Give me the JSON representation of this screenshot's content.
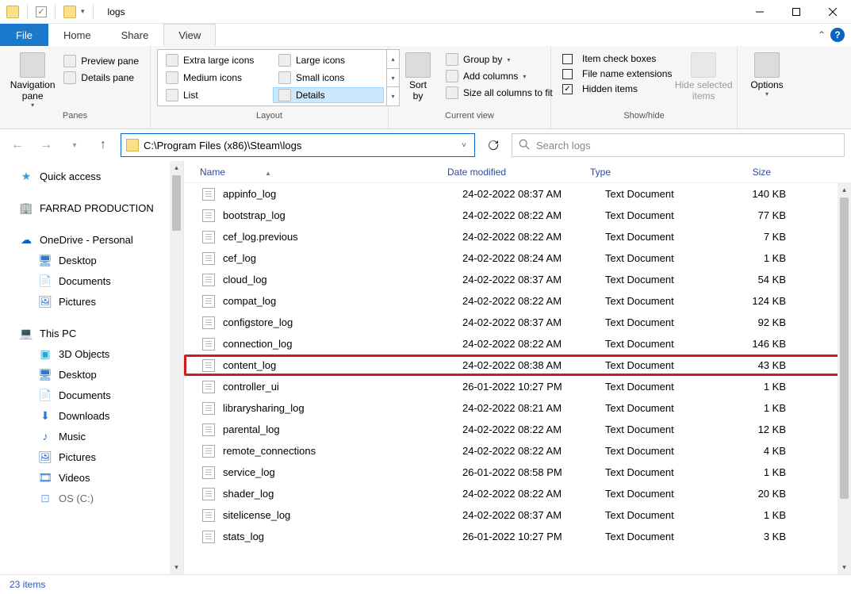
{
  "title": "logs",
  "tabs": {
    "file": "File",
    "home": "Home",
    "share": "Share",
    "view": "View"
  },
  "ribbon": {
    "panes_group": "Panes",
    "nav_pane": "Navigation\npane",
    "preview_pane": "Preview pane",
    "details_pane": "Details pane",
    "layout_group": "Layout",
    "layout": {
      "xl": "Extra large icons",
      "lg": "Large icons",
      "md": "Medium icons",
      "sm": "Small icons",
      "list": "List",
      "details": "Details"
    },
    "currentview_group": "Current view",
    "sort_by": "Sort\nby",
    "group_by": "Group by",
    "add_columns": "Add columns",
    "size_all": "Size all columns to fit",
    "showhide_group": "Show/hide",
    "item_check": "Item check boxes",
    "file_ext": "File name extensions",
    "hidden": "Hidden items",
    "hide_selected": "Hide selected\nitems",
    "options": "Options"
  },
  "address_path": "C:\\Program Files (x86)\\Steam\\logs",
  "search_placeholder": "Search logs",
  "nav": {
    "quick": "Quick access",
    "farrad": "FARRAD PRODUCTION",
    "onedrive": "OneDrive - Personal",
    "od_desktop": "Desktop",
    "od_documents": "Documents",
    "od_pictures": "Pictures",
    "thispc": "This PC",
    "3d": "3D Objects",
    "desktop": "Desktop",
    "documents": "Documents",
    "downloads": "Downloads",
    "music": "Music",
    "pictures": "Pictures",
    "videos": "Videos",
    "osc": "OS (C:)"
  },
  "columns": {
    "name": "Name",
    "date": "Date modified",
    "type": "Type",
    "size": "Size"
  },
  "files": [
    {
      "name": "appinfo_log",
      "date": "24-02-2022 08:37 AM",
      "type": "Text Document",
      "size": "140 KB",
      "hl": false
    },
    {
      "name": "bootstrap_log",
      "date": "24-02-2022 08:22 AM",
      "type": "Text Document",
      "size": "77 KB",
      "hl": false
    },
    {
      "name": "cef_log.previous",
      "date": "24-02-2022 08:22 AM",
      "type": "Text Document",
      "size": "7 KB",
      "hl": false
    },
    {
      "name": "cef_log",
      "date": "24-02-2022 08:24 AM",
      "type": "Text Document",
      "size": "1 KB",
      "hl": false
    },
    {
      "name": "cloud_log",
      "date": "24-02-2022 08:37 AM",
      "type": "Text Document",
      "size": "54 KB",
      "hl": false
    },
    {
      "name": "compat_log",
      "date": "24-02-2022 08:22 AM",
      "type": "Text Document",
      "size": "124 KB",
      "hl": false
    },
    {
      "name": "configstore_log",
      "date": "24-02-2022 08:37 AM",
      "type": "Text Document",
      "size": "92 KB",
      "hl": false
    },
    {
      "name": "connection_log",
      "date": "24-02-2022 08:22 AM",
      "type": "Text Document",
      "size": "146 KB",
      "hl": false
    },
    {
      "name": "content_log",
      "date": "24-02-2022 08:38 AM",
      "type": "Text Document",
      "size": "43 KB",
      "hl": true
    },
    {
      "name": "controller_ui",
      "date": "26-01-2022 10:27 PM",
      "type": "Text Document",
      "size": "1 KB",
      "hl": false
    },
    {
      "name": "librarysharing_log",
      "date": "24-02-2022 08:21 AM",
      "type": "Text Document",
      "size": "1 KB",
      "hl": false
    },
    {
      "name": "parental_log",
      "date": "24-02-2022 08:22 AM",
      "type": "Text Document",
      "size": "12 KB",
      "hl": false
    },
    {
      "name": "remote_connections",
      "date": "24-02-2022 08:22 AM",
      "type": "Text Document",
      "size": "4 KB",
      "hl": false
    },
    {
      "name": "service_log",
      "date": "26-01-2022 08:58 PM",
      "type": "Text Document",
      "size": "1 KB",
      "hl": false
    },
    {
      "name": "shader_log",
      "date": "24-02-2022 08:22 AM",
      "type": "Text Document",
      "size": "20 KB",
      "hl": false
    },
    {
      "name": "sitelicense_log",
      "date": "24-02-2022 08:37 AM",
      "type": "Text Document",
      "size": "1 KB",
      "hl": false
    },
    {
      "name": "stats_log",
      "date": "26-01-2022 10:27 PM",
      "type": "Text Document",
      "size": "3 KB",
      "hl": false
    }
  ],
  "status": "23 items"
}
